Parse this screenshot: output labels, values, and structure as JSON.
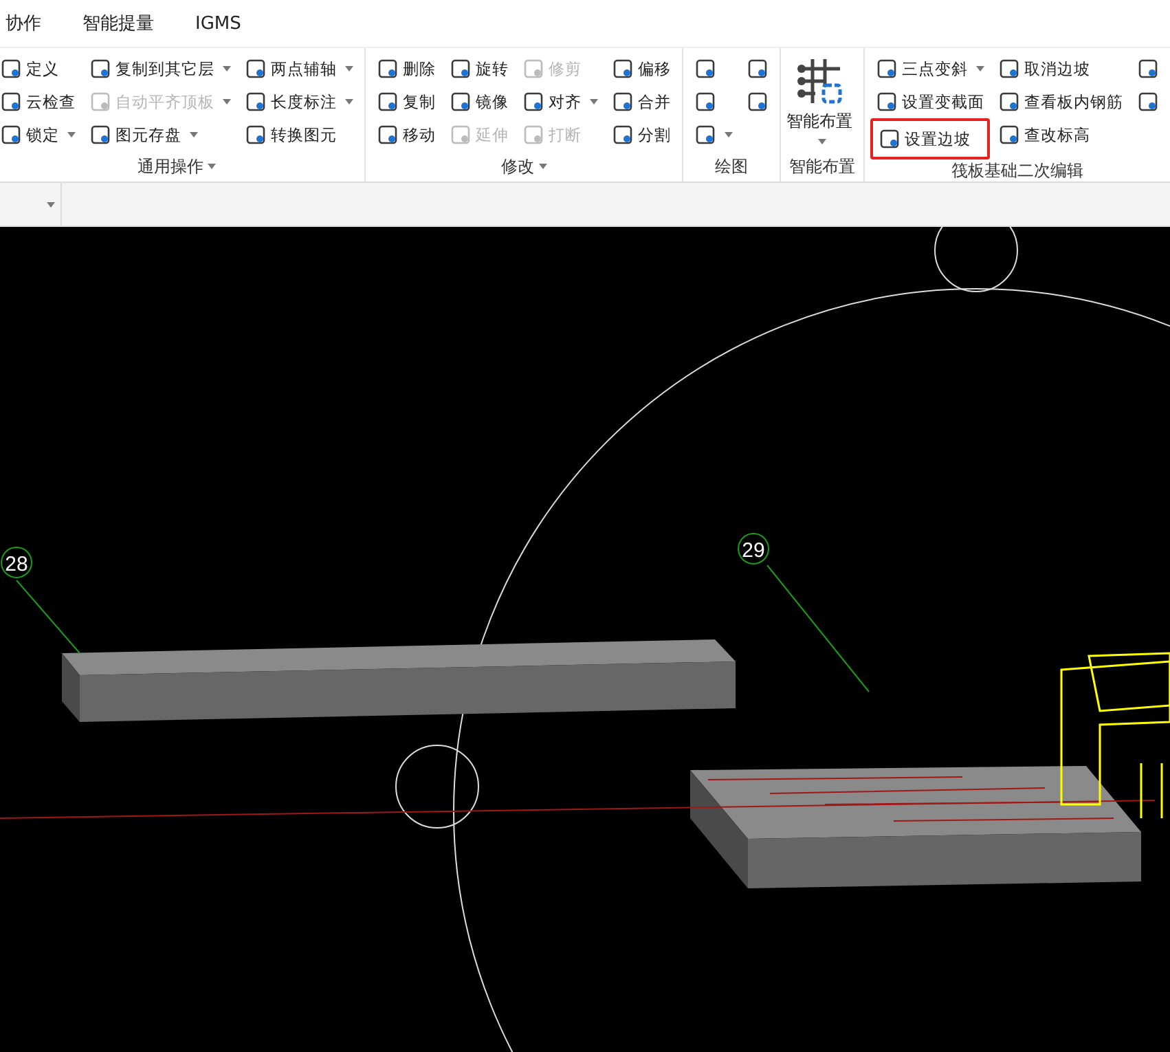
{
  "tabs": [
    {
      "label": "协作",
      "selected": false
    },
    {
      "label": "智能提量",
      "selected": false
    },
    {
      "label": "IGMS",
      "selected": false
    }
  ],
  "ribbon": {
    "groups": [
      {
        "title": "通用操作",
        "has_menu": true,
        "columns": [
          [
            {
              "label": "定义",
              "disabled": false,
              "dropdown": false,
              "highlighted": false
            },
            {
              "label": "云检查",
              "disabled": false,
              "dropdown": false,
              "highlighted": false
            },
            {
              "label": "锁定",
              "disabled": false,
              "dropdown": true,
              "highlighted": false
            }
          ],
          [
            {
              "label": "复制到其它层",
              "disabled": false,
              "dropdown": true,
              "highlighted": false
            },
            {
              "label": "自动平齐顶板",
              "disabled": true,
              "dropdown": true,
              "highlighted": false
            },
            {
              "label": "图元存盘",
              "disabled": false,
              "dropdown": true,
              "highlighted": false
            }
          ],
          [
            {
              "label": "两点辅轴",
              "disabled": false,
              "dropdown": true,
              "highlighted": false
            },
            {
              "label": "长度标注",
              "disabled": false,
              "dropdown": true,
              "highlighted": false
            },
            {
              "label": "转换图元",
              "disabled": false,
              "dropdown": false,
              "highlighted": false
            }
          ]
        ]
      },
      {
        "title": "修改",
        "has_menu": true,
        "columns": [
          [
            {
              "label": "删除",
              "disabled": false,
              "dropdown": false,
              "highlighted": false
            },
            {
              "label": "复制",
              "disabled": false,
              "dropdown": false,
              "highlighted": false
            },
            {
              "label": "移动",
              "disabled": false,
              "dropdown": false,
              "highlighted": false
            }
          ],
          [
            {
              "label": "旋转",
              "disabled": false,
              "dropdown": false,
              "highlighted": false
            },
            {
              "label": "镜像",
              "disabled": false,
              "dropdown": false,
              "highlighted": false
            },
            {
              "label": "延伸",
              "disabled": true,
              "dropdown": false,
              "highlighted": false
            }
          ],
          [
            {
              "label": "修剪",
              "disabled": true,
              "dropdown": false,
              "highlighted": false
            },
            {
              "label": "对齐",
              "disabled": false,
              "dropdown": true,
              "highlighted": false
            },
            {
              "label": "打断",
              "disabled": true,
              "dropdown": false,
              "highlighted": false
            }
          ],
          [
            {
              "label": "偏移",
              "disabled": false,
              "dropdown": false,
              "highlighted": false
            },
            {
              "label": "合并",
              "disabled": false,
              "dropdown": false,
              "highlighted": false
            },
            {
              "label": "分割",
              "disabled": false,
              "dropdown": false,
              "highlighted": false
            }
          ]
        ]
      },
      {
        "title": "绘图",
        "has_menu": false,
        "columns": [
          [
            {
              "disabled": false,
              "dropdown": false,
              "highlighted": false
            },
            {
              "disabled": false,
              "dropdown": false,
              "highlighted": false
            },
            {
              "disabled": false,
              "dropdown": true,
              "highlighted": false
            }
          ],
          [
            {
              "disabled": false,
              "dropdown": false,
              "highlighted": false
            },
            {
              "disabled": false,
              "dropdown": false,
              "highlighted": false
            }
          ]
        ]
      },
      {
        "title": "智能布置",
        "has_menu": false,
        "big": {
          "label": "智能布置",
          "dropdown": true
        }
      },
      {
        "title": "筏板基础二次编辑",
        "has_menu": false,
        "columns": [
          [
            {
              "label": "三点变斜",
              "disabled": false,
              "dropdown": true,
              "highlighted": false
            },
            {
              "label": "设置变截面",
              "disabled": false,
              "dropdown": false,
              "highlighted": false
            },
            {
              "label": "设置边坡",
              "disabled": false,
              "dropdown": false,
              "highlighted": true
            }
          ],
          [
            {
              "label": "取消边坡",
              "disabled": false,
              "dropdown": false,
              "highlighted": false
            },
            {
              "label": "查看板内钢筋",
              "disabled": false,
              "dropdown": false,
              "highlighted": false
            },
            {
              "label": "查改标高",
              "disabled": false,
              "dropdown": false,
              "highlighted": false
            }
          ],
          [
            {
              "disabled": false,
              "dropdown": false,
              "highlighted": false
            },
            {
              "disabled": false,
              "dropdown": false,
              "highlighted": false
            }
          ]
        ]
      }
    ]
  },
  "combo": {
    "dropdown": true
  },
  "canvas": {
    "axis_labels": [
      "28",
      "29"
    ]
  }
}
